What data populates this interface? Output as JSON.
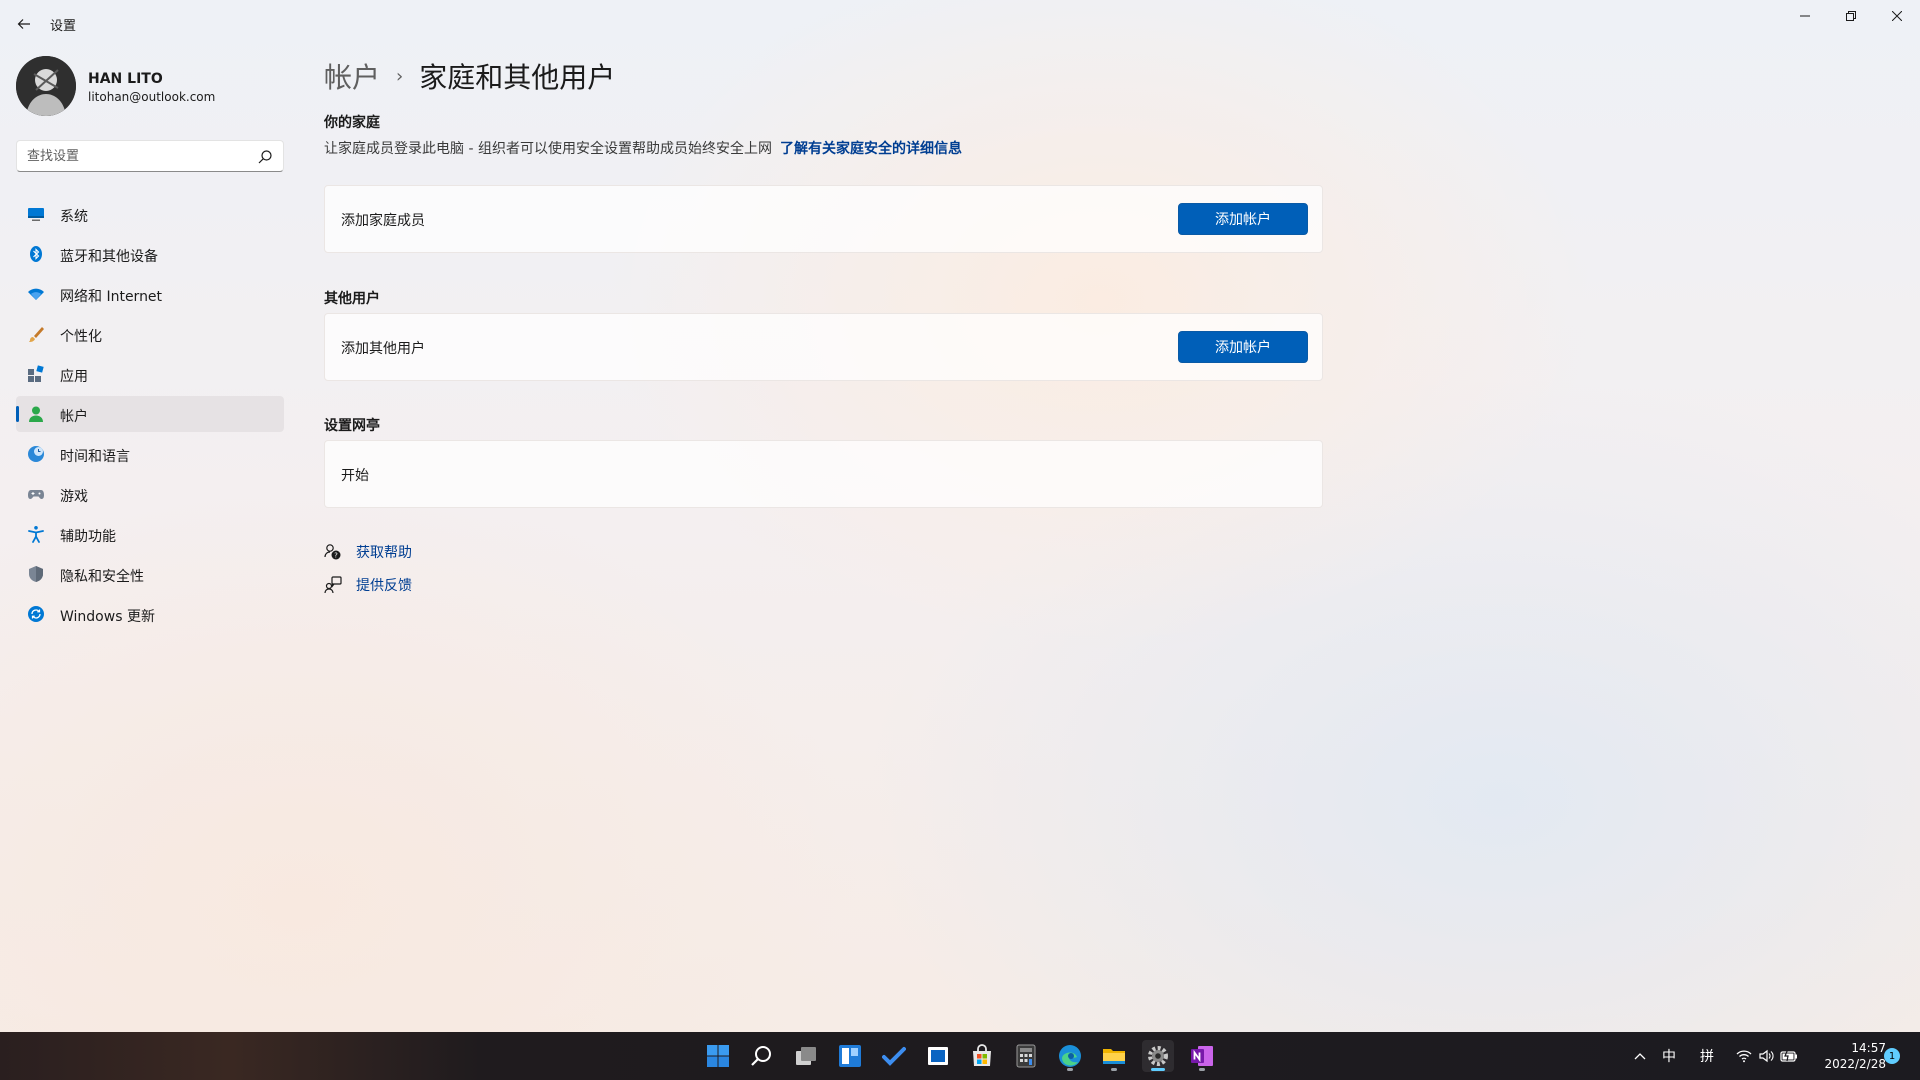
{
  "window": {
    "app_title": "设置",
    "back_glyph": "←",
    "min_glyph": "—",
    "max_glyph": "❐",
    "close_glyph": "✕"
  },
  "profile": {
    "name": "HAN LITO",
    "email": "litohan@outlook.com"
  },
  "search": {
    "placeholder": "查找设置",
    "value": ""
  },
  "sidebar": {
    "items": [
      {
        "label": "系统",
        "icon": "system-icon",
        "active": false
      },
      {
        "label": "蓝牙和其他设备",
        "icon": "bluetooth-icon",
        "active": false
      },
      {
        "label": "网络和 Internet",
        "icon": "wifi-icon",
        "active": false
      },
      {
        "label": "个性化",
        "icon": "brush-icon",
        "active": false
      },
      {
        "label": "应用",
        "icon": "apps-icon",
        "active": false
      },
      {
        "label": "帐户",
        "icon": "account-icon",
        "active": true
      },
      {
        "label": "时间和语言",
        "icon": "globe-clock-icon",
        "active": false
      },
      {
        "label": "游戏",
        "icon": "gamepad-icon",
        "active": false
      },
      {
        "label": "辅助功能",
        "icon": "accessibility-icon",
        "active": false
      },
      {
        "label": "隐私和安全性",
        "icon": "shield-icon",
        "active": false
      },
      {
        "label": "Windows 更新",
        "icon": "update-icon",
        "active": false
      }
    ]
  },
  "main": {
    "breadcrumb_parent": "帐户",
    "breadcrumb_sep": "›",
    "page_title": "家庭和其他用户",
    "family": {
      "heading": "你的家庭",
      "description": "让家庭成员登录此电脑 - 组织者可以使用安全设置帮助成员始终安全上网",
      "link": "了解有关家庭安全的详细信息",
      "card_label": "添加家庭成员",
      "button": "添加帐户"
    },
    "other_users": {
      "heading": "其他用户",
      "card_label": "添加其他用户",
      "button": "添加帐户"
    },
    "kiosk": {
      "heading": "设置网亭",
      "card_label": "开始"
    },
    "help": {
      "get_help": "获取帮助",
      "feedback": "提供反馈"
    }
  },
  "taskbar": {
    "apps": [
      "start-icon",
      "search-icon",
      "task-view-icon",
      "widgets-icon",
      "todo-icon",
      "store-app-icon",
      "microsoft-store-icon",
      "calculator-icon",
      "edge-icon",
      "file-explorer-icon",
      "settings-icon",
      "onenote-icon"
    ],
    "tray": {
      "chevron": "^",
      "ime_mode": "中",
      "ime_layout": "拼"
    },
    "time": "14:57",
    "date": "2022/2/28",
    "notification_count": "1"
  },
  "colors": {
    "accent": "#005fb8",
    "link": "#003e92",
    "taskbar_active": "#60cdff"
  }
}
